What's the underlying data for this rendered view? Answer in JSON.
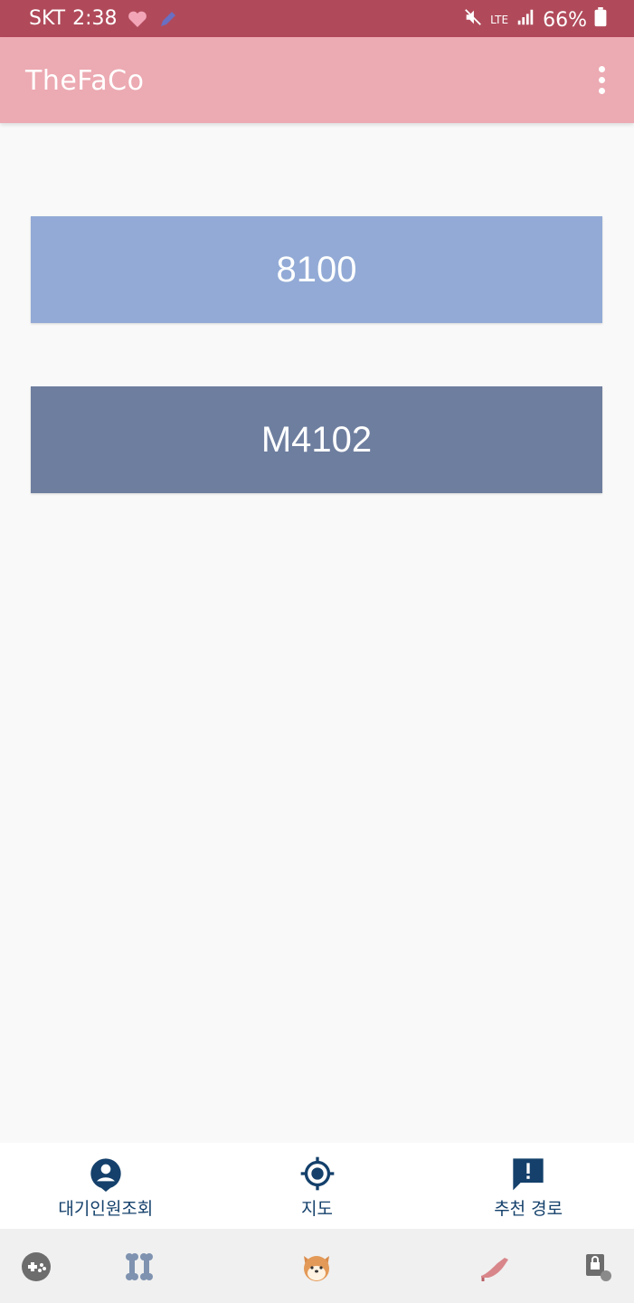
{
  "status_bar": {
    "carrier": "SKT",
    "time": "2:38",
    "network": "LTE",
    "battery": "66%",
    "icons": [
      "heart-icon",
      "pencil-icon",
      "mute-icon",
      "signal-icon",
      "battery-icon"
    ]
  },
  "app_bar": {
    "title": "TheFaCo",
    "menu_icon": "more-vert-icon"
  },
  "routes": [
    {
      "label": "8100",
      "color": "#92aad5"
    },
    {
      "label": "M4102",
      "color": "#6e7e9f"
    }
  ],
  "bottom_nav": [
    {
      "label": "대기인원조회",
      "icon": "person-pin-icon"
    },
    {
      "label": "지도",
      "icon": "my-location-icon"
    },
    {
      "label": "추천 경로",
      "icon": "feedback-icon"
    }
  ],
  "colors": {
    "status_bar": "#b04a5a",
    "app_bar": "#ecaab2",
    "nav_accent": "#14406b"
  },
  "system_nav_icons": [
    "game-icon",
    "bone-icon",
    "shiba-dog-icon",
    "shoe-icon",
    "lock-touch-icon"
  ]
}
